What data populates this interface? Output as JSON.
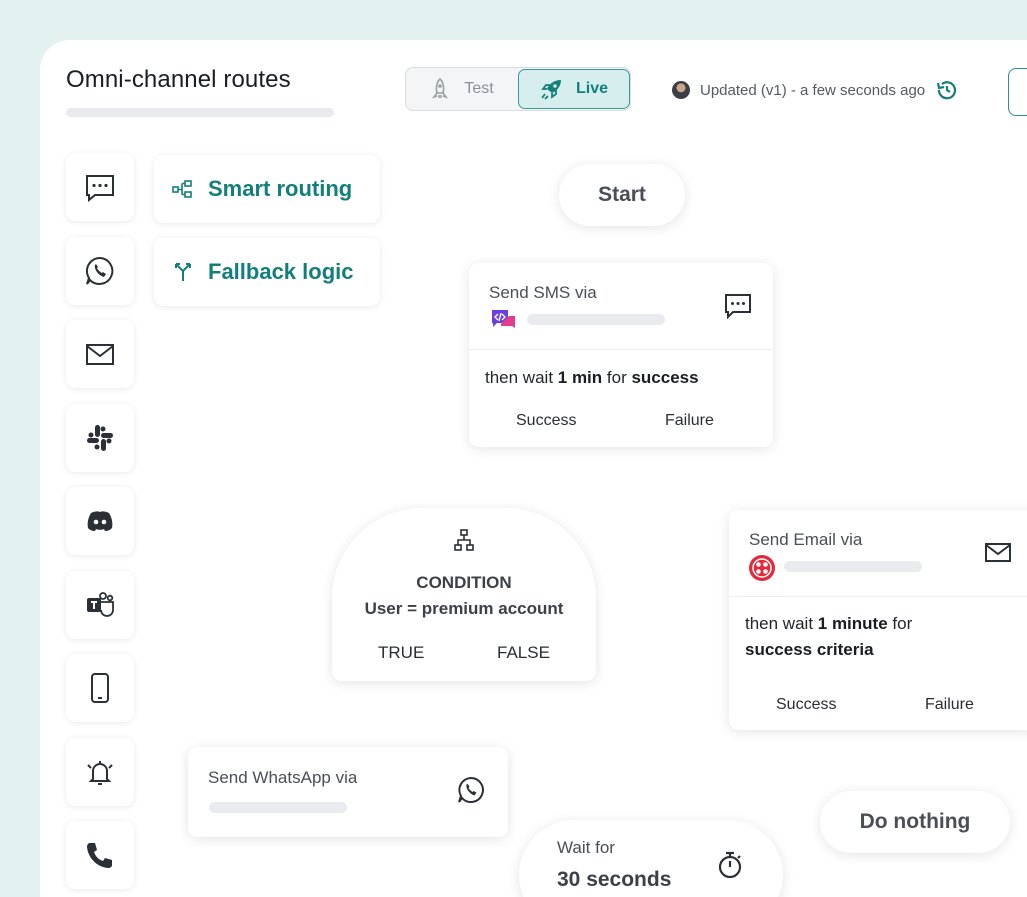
{
  "header": {
    "title": "Omni-channel routes",
    "mode_test_label": "Test",
    "mode_live_label": "Live",
    "updated_text": "Updated (v1) - a few seconds ago"
  },
  "features": [
    {
      "label": "Smart routing",
      "icon": "smart-routing-icon"
    },
    {
      "label": "Fallback logic",
      "icon": "fallback-logic-icon"
    }
  ],
  "channels": [
    "sms-icon",
    "whatsapp-icon",
    "email-icon",
    "slack-icon",
    "discord-icon",
    "teams-icon",
    "mobile-push-icon",
    "in-app-bell-icon",
    "phone-call-icon"
  ],
  "flow": {
    "start_label": "Start",
    "sms_node": {
      "title": "Send SMS via",
      "wait_prefix": "then wait ",
      "wait_value": "1 min",
      "wait_mid": " for ",
      "wait_criteria": "success",
      "success_label": "Success",
      "failure_label": "Failure"
    },
    "condition_node": {
      "heading": "CONDITION",
      "expression": "User = premium account",
      "true_label": "TRUE",
      "false_label": "FALSE"
    },
    "email_node": {
      "title": "Send Email via",
      "wait_prefix": "then wait ",
      "wait_value": "1 minute",
      "wait_mid": " for",
      "wait_criteria": "success criteria",
      "success_label": "Success",
      "failure_label": "Failure"
    },
    "whatsapp_node": {
      "title": "Send WhatsApp via"
    },
    "wait_node": {
      "title": "Wait for",
      "duration": "30 seconds"
    },
    "do_nothing_label": "Do nothing"
  },
  "colors": {
    "accent": "#137f7b",
    "background": "#e3f1f1",
    "live_bg": "#d6efee"
  }
}
